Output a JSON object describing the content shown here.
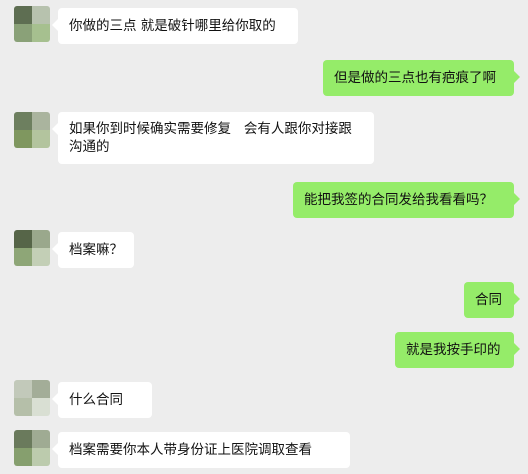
{
  "colors": {
    "background": "#ededed",
    "incoming_bubble": "#ffffff",
    "outgoing_bubble": "#95ec69"
  },
  "messages": [
    {
      "side": "left",
      "text": "你做的三点 就是破针哪里给你取的"
    },
    {
      "side": "right",
      "text": "但是做的三点也有疤痕了啊"
    },
    {
      "side": "left",
      "text": "如果你到时候确实需要修复   会有人跟你对接跟\n沟通的"
    },
    {
      "side": "right",
      "text": "能把我签的合同发给我看看吗？"
    },
    {
      "side": "left",
      "text": "档案嘛？"
    },
    {
      "side": "right",
      "text": "合同"
    },
    {
      "side": "right",
      "text": "就是我按手印的"
    },
    {
      "side": "left",
      "text": "什么合同"
    },
    {
      "side": "left",
      "text": "档案需要你本人带身份证上医院调取查看"
    }
  ]
}
